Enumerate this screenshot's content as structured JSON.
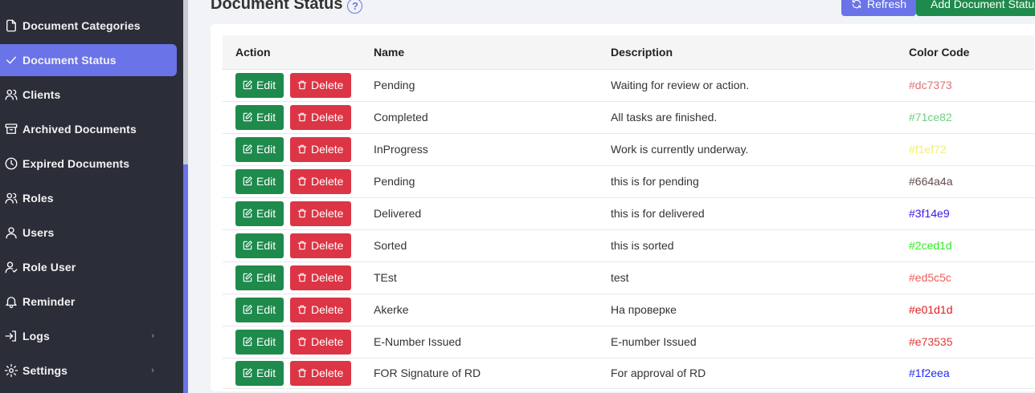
{
  "sidebar": {
    "items": [
      {
        "label": "Document Categories",
        "icon": "file-icon",
        "active": false
      },
      {
        "label": "Document Status",
        "icon": "check-icon",
        "active": true
      },
      {
        "label": "Clients",
        "icon": "users-icon",
        "active": false
      },
      {
        "label": "Archived Documents",
        "icon": "archive-icon",
        "active": false
      },
      {
        "label": "Expired Documents",
        "icon": "clock-icon",
        "active": false
      },
      {
        "label": "Roles",
        "icon": "users-icon",
        "active": false
      },
      {
        "label": "Users",
        "icon": "user-icon",
        "active": false
      },
      {
        "label": "Role User",
        "icon": "user-check-icon",
        "active": false
      },
      {
        "label": "Reminder",
        "icon": "bell-icon",
        "active": false
      },
      {
        "label": "Logs",
        "icon": "login-icon",
        "active": false,
        "chevron": "›"
      },
      {
        "label": "Settings",
        "icon": "gear-icon",
        "active": false,
        "chevron": "›"
      }
    ]
  },
  "header": {
    "title": "Document Status",
    "help": "?",
    "refresh_label": "Refresh",
    "add_label": "Add Document Status"
  },
  "table": {
    "columns": [
      "Action",
      "Name",
      "Description",
      "Color Code"
    ],
    "edit_label": "Edit",
    "delete_label": "Delete",
    "rows": [
      {
        "name": "Pending",
        "description": "Waiting for review or action.",
        "color": "#dc7373"
      },
      {
        "name": "Completed",
        "description": "All tasks are finished.",
        "color": "#71ce82"
      },
      {
        "name": "InProgress",
        "description": "Work is currently underway.",
        "color": "#f1ef72"
      },
      {
        "name": "Pending",
        "description": "this is for pending",
        "color": "#664a4a"
      },
      {
        "name": "Delivered",
        "description": "this is for delivered",
        "color": "#3f14e9"
      },
      {
        "name": "Sorted",
        "description": "this is sorted",
        "color": "#2ced1d"
      },
      {
        "name": "TEst",
        "description": "test",
        "color": "#ed5c5c"
      },
      {
        "name": "Akerke",
        "description": "На проверке",
        "color": "#e01d1d"
      },
      {
        "name": "E-Number Issued",
        "description": "E-number Issued",
        "color": "#e73535"
      },
      {
        "name": "FOR Signature of RD",
        "description": "For approval of RD",
        "color": "#1f2eea"
      }
    ]
  },
  "colors": {
    "accent": "#6a73e8",
    "success": "#1e8a4c",
    "danger": "#dc3545",
    "sidebar_bg": "#2b2e38"
  }
}
